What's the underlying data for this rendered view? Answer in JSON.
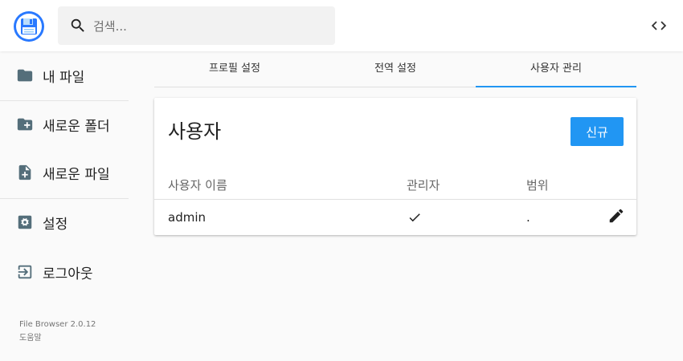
{
  "header": {
    "search_placeholder": "검색...",
    "logo_icon": "file-browser-logo-icon",
    "code_icon": "code-icon"
  },
  "sidebar": {
    "items": [
      {
        "label": "내 파일",
        "icon": "folder-icon"
      },
      {
        "label": "새로운 폴더",
        "icon": "create-new-folder-icon"
      },
      {
        "label": "새로운 파일",
        "icon": "note-add-icon"
      },
      {
        "label": "설정",
        "icon": "settings-icon"
      },
      {
        "label": "로그아웃",
        "icon": "exit-icon"
      }
    ],
    "version": "File Browser 2.0.12",
    "help": "도움말"
  },
  "tabs": [
    {
      "label": "프로필 설정",
      "active": false
    },
    {
      "label": "전역 설정",
      "active": false
    },
    {
      "label": "사용자 관리",
      "active": true
    }
  ],
  "users": {
    "title": "사용자",
    "new_button": "신규",
    "columns": [
      "사용자 이름",
      "관리자",
      "범위"
    ],
    "rows": [
      {
        "username": "admin",
        "admin": true,
        "scope": "."
      }
    ]
  },
  "colors": {
    "accent": "#2196f3",
    "logo_blue": "#2979ff"
  }
}
